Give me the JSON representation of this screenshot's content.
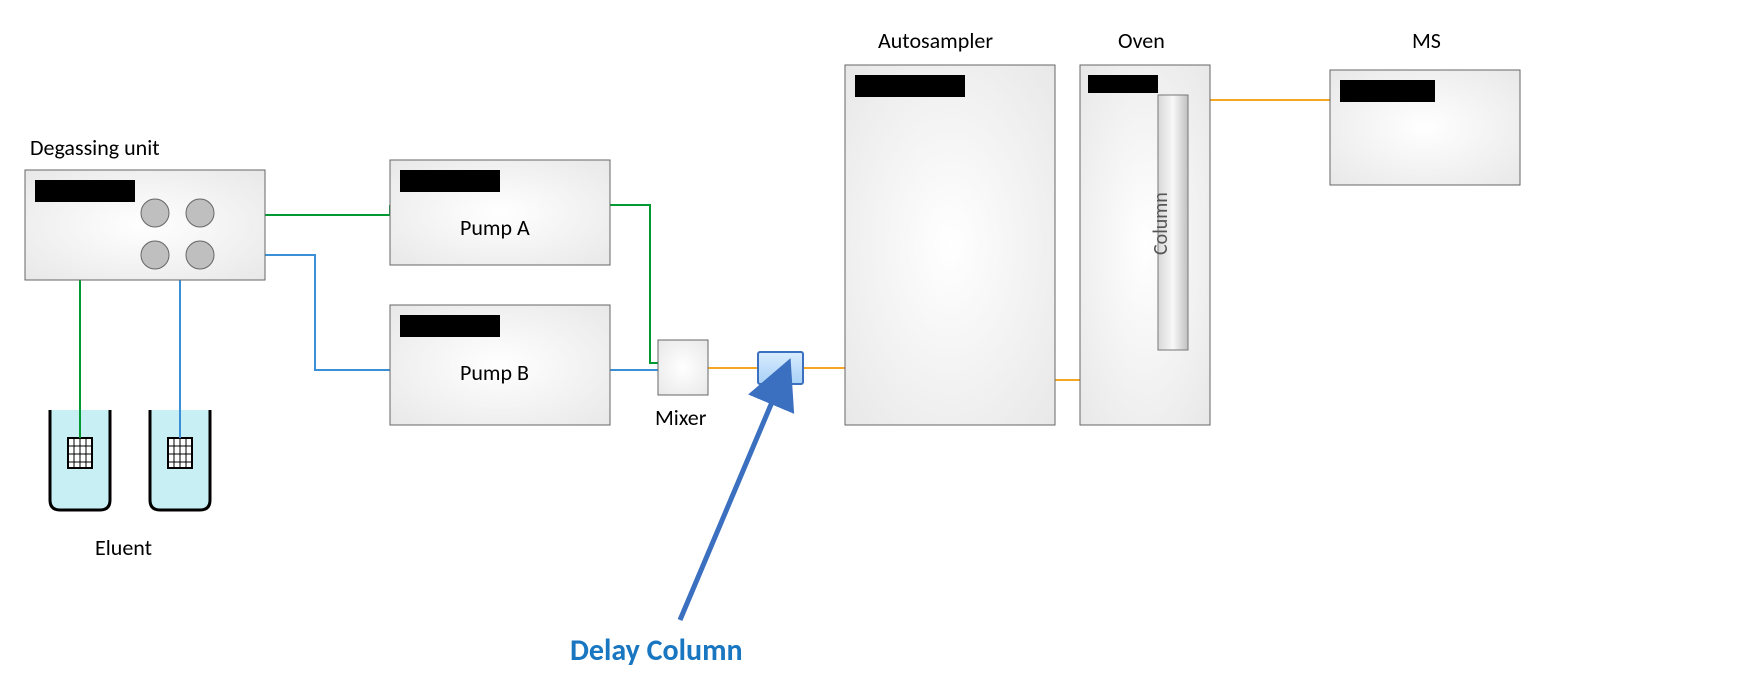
{
  "labels": {
    "degassing": "Degassing unit",
    "eluent": "Eluent",
    "pumpA": "Pump A",
    "pumpB": "Pump B",
    "mixer": "Mixer",
    "autosampler": "Autosampler",
    "oven": "Oven",
    "column": "Column",
    "ms": "MS",
    "delayColumn": "Delay Column"
  },
  "colors": {
    "lineGreen": "#009933",
    "lineBlue": "#3b8fd6",
    "lineOrange": "#f5a623",
    "boxFill": "#efefef",
    "boxStroke": "#666666",
    "delayFill": "#bfe0ff",
    "delayStroke": "#3b6fbf",
    "eluentFill": "#c8f0f4",
    "arrowColor": "#3b6fbf"
  },
  "components": [
    {
      "id": "degassing",
      "type": "unit",
      "role": "degasser"
    },
    {
      "id": "eluent-a",
      "type": "reservoir",
      "role": "mobile-phase-a"
    },
    {
      "id": "eluent-b",
      "type": "reservoir",
      "role": "mobile-phase-b"
    },
    {
      "id": "pump-a",
      "type": "pump"
    },
    {
      "id": "pump-b",
      "type": "pump"
    },
    {
      "id": "mixer",
      "type": "mixer"
    },
    {
      "id": "delay-column",
      "type": "delay-column",
      "highlighted": true
    },
    {
      "id": "autosampler",
      "type": "autosampler"
    },
    {
      "id": "oven",
      "type": "oven"
    },
    {
      "id": "column",
      "type": "analytical-column"
    },
    {
      "id": "ms",
      "type": "detector",
      "role": "mass-spectrometer"
    }
  ],
  "flow": [
    [
      "eluent-a",
      "degassing",
      "lineGreen"
    ],
    [
      "eluent-b",
      "degassing",
      "lineBlue"
    ],
    [
      "degassing",
      "pump-a",
      "lineGreen"
    ],
    [
      "degassing",
      "pump-b",
      "lineBlue"
    ],
    [
      "pump-a",
      "mixer",
      "lineGreen"
    ],
    [
      "pump-b",
      "mixer",
      "lineBlue"
    ],
    [
      "mixer",
      "delay-column",
      "lineOrange"
    ],
    [
      "delay-column",
      "autosampler",
      "lineOrange"
    ],
    [
      "autosampler",
      "oven",
      "lineOrange"
    ],
    [
      "oven",
      "column",
      "lineOrange"
    ],
    [
      "column",
      "ms",
      "lineOrange"
    ]
  ]
}
